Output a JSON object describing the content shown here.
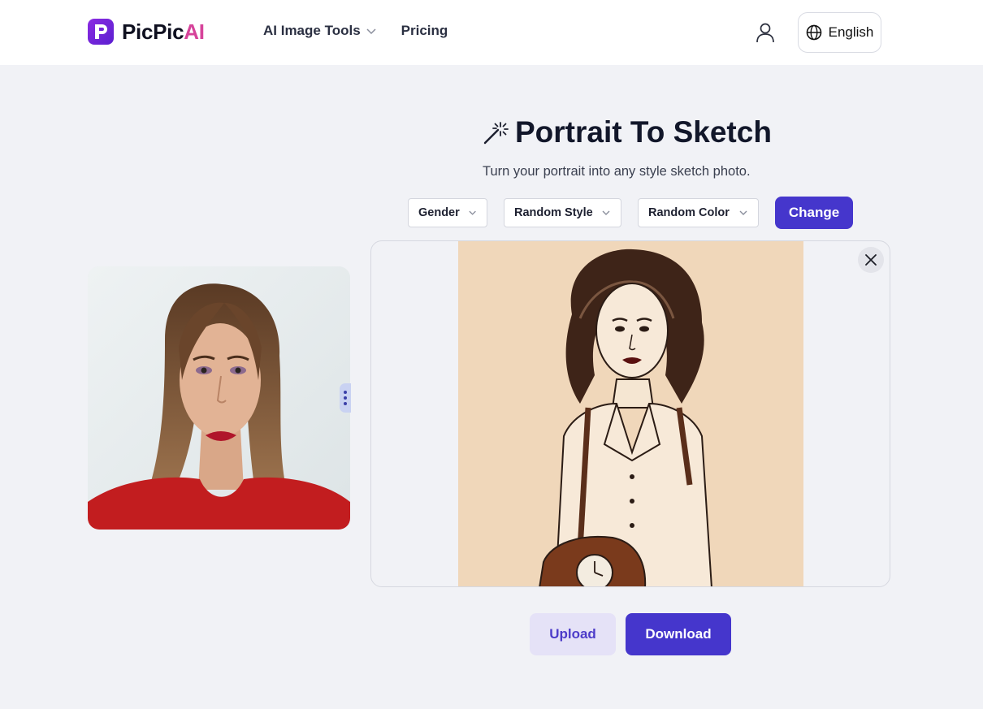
{
  "header": {
    "logo": {
      "brand_prefix": "PicPic",
      "brand_suffix": "AI",
      "icon": "picpicai-logo-icon",
      "mark_letter": "P"
    },
    "nav": [
      {
        "label": "AI Image Tools",
        "icon": "chevron-down-icon"
      },
      {
        "label": "Pricing"
      }
    ],
    "user_icon": "user-icon",
    "language": {
      "label": "English",
      "icon": "globe-icon"
    }
  },
  "tool": {
    "title": "Portrait To Sketch",
    "title_icon": "magic-wand-icon",
    "subtitle": "Turn your portrait into any style sketch photo."
  },
  "controls": {
    "gender": {
      "selected": "Gender"
    },
    "style": {
      "selected": "Random Style"
    },
    "color": {
      "selected": "Random Color"
    },
    "change_label": "Change"
  },
  "images": {
    "original_alt": "original portrait",
    "result_alt": "sketch result"
  },
  "actions": {
    "upload_label": "Upload",
    "download_label": "Download"
  },
  "colors": {
    "primary": "#4536cc",
    "primary_soft": "#e5e2f7",
    "page_bg": "#f1f2f6",
    "logo_accent": "#d6439a",
    "sketch_bg": "#f0d7ba"
  }
}
